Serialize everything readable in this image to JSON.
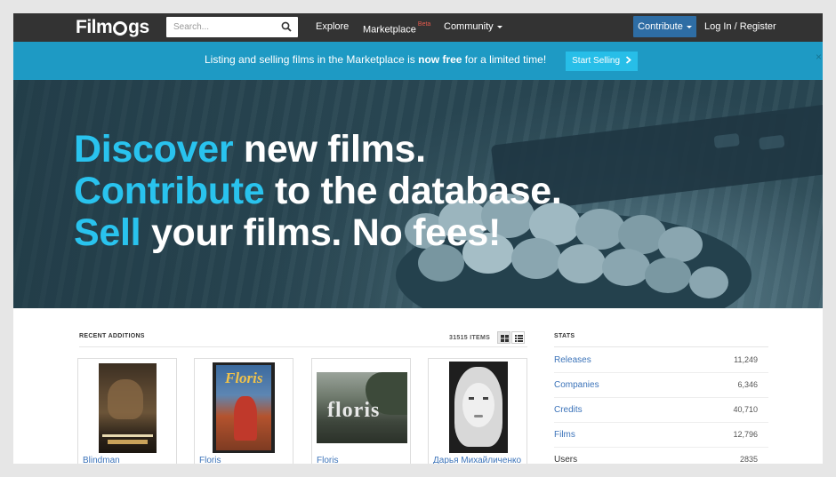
{
  "brand": {
    "logo_text_a": "Film",
    "logo_text_b": "gs"
  },
  "search": {
    "placeholder": "Search..."
  },
  "nav": {
    "explore": "Explore",
    "marketplace": "Marketplace",
    "marketplace_badge": "Beta",
    "community": "Community",
    "contribute": "Contribute",
    "login": "Log In / Register"
  },
  "banner": {
    "text_before": "Listing and selling films in the Marketplace is ",
    "text_bold": "now free",
    "text_after": " for a limited time!",
    "button": "Start Selling",
    "close": "×"
  },
  "hero": {
    "line1_highlight": "Discover",
    "line1_rest": " new films.",
    "line2_highlight": "Contribute",
    "line2_rest": " to the database.",
    "line3_highlight": "Sell",
    "line3_rest": " your films. No fees!"
  },
  "recent": {
    "title": "RECENT ADDITIONS",
    "count": "31515 ITEMS",
    "items": [
      {
        "title": "Blindman"
      },
      {
        "title": "Floris"
      },
      {
        "title": "Floris"
      },
      {
        "title": "Дарья Михайличенко"
      }
    ]
  },
  "stats": {
    "title": "STATS",
    "rows": [
      {
        "label": "Releases",
        "value": "11,249"
      },
      {
        "label": "Companies",
        "value": "6,346"
      },
      {
        "label": "Credits",
        "value": "40,710"
      },
      {
        "label": "Films",
        "value": "12,796"
      },
      {
        "label": "Users",
        "value": "2835"
      }
    ]
  },
  "colors": {
    "navbar": "#333333",
    "banner": "#1e9ac4",
    "accent": "#29c3ee",
    "link": "#3b73b9",
    "contribute_button": "#2e6da4"
  }
}
